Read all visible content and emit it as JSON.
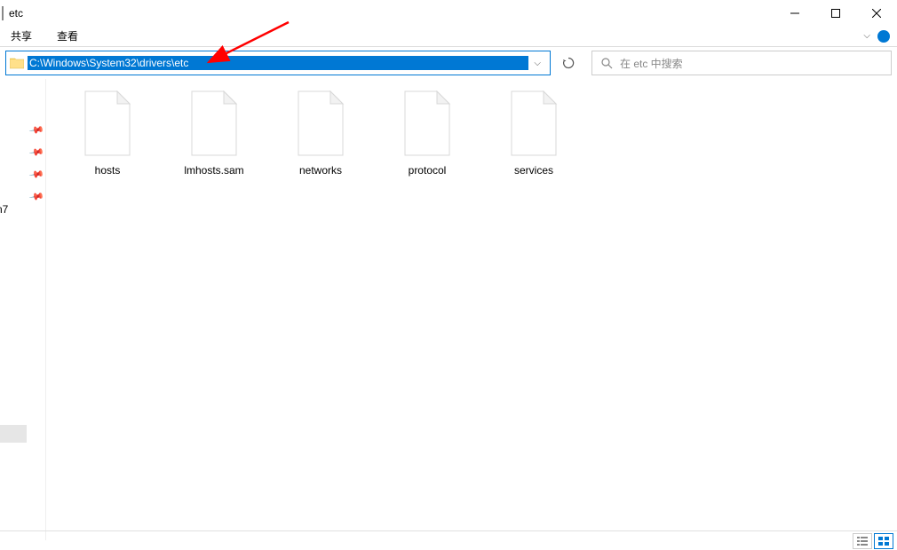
{
  "window": {
    "title": "etc"
  },
  "ribbon": {
    "tabs": [
      "共享",
      "查看"
    ]
  },
  "address_bar": {
    "path": "C:\\Windows\\System32\\drivers\\etc"
  },
  "search": {
    "placeholder": "在 etc 中搜索"
  },
  "sidebar": {
    "partial_text": "n7"
  },
  "files": [
    {
      "name": "hosts"
    },
    {
      "name": "lmhosts.sam"
    },
    {
      "name": "networks"
    },
    {
      "name": "protocol"
    },
    {
      "name": "services"
    }
  ],
  "status": {
    "views": [
      "details",
      "large-icons"
    ]
  }
}
